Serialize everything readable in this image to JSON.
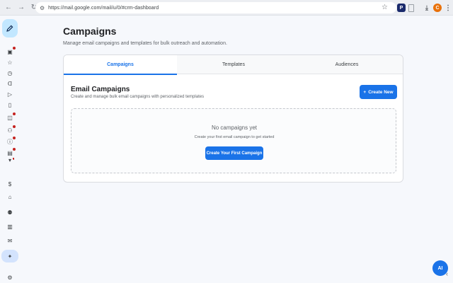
{
  "browser": {
    "url": "https://mail.google.com/mail/u/0/#crm-dashboard",
    "avatar_letter": "C",
    "extension_letter": "P"
  },
  "rail": {
    "icons": [
      {
        "name": "inbox-icon",
        "glyph": "▣",
        "dot": true
      },
      {
        "name": "star-icon",
        "glyph": "☆",
        "dot": false
      },
      {
        "name": "clock-icon",
        "glyph": "◷",
        "dot": false
      },
      {
        "name": "label-icon",
        "glyph": "ᗡ",
        "dot": false
      },
      {
        "name": "send-icon",
        "glyph": "▷",
        "dot": false
      },
      {
        "name": "draft-icon",
        "glyph": "▯",
        "dot": false
      },
      {
        "name": "bag-icon",
        "glyph": "◫",
        "dot": true
      },
      {
        "name": "people-icon",
        "glyph": "⚇",
        "dot": true
      },
      {
        "name": "info-icon",
        "glyph": "ⓘ",
        "dot": true
      },
      {
        "name": "chat-icon",
        "glyph": "▤",
        "dot": true
      },
      {
        "name": "more-icon",
        "glyph": "▾",
        "dot": true
      },
      {
        "name": "dollar-icon",
        "glyph": "$",
        "dot": false
      },
      {
        "name": "home-icon",
        "glyph": "⌂",
        "dot": false
      },
      {
        "name": "contacts-icon",
        "glyph": "⚉",
        "dot": false
      },
      {
        "name": "analytics-icon",
        "glyph": "▥",
        "dot": false
      },
      {
        "name": "campaigns-icon",
        "glyph": "✉",
        "dot": false
      },
      {
        "name": "sparkle-icon",
        "glyph": "✦",
        "dot": false
      },
      {
        "name": "settings-icon",
        "glyph": "⚙",
        "dot": false
      }
    ]
  },
  "page": {
    "title": "Campaigns",
    "subtitle": "Manage email campaigns and templates for bulk outreach and automation."
  },
  "tabs": [
    {
      "label": "Campaigns",
      "active": true
    },
    {
      "label": "Templates",
      "active": false
    },
    {
      "label": "Audiences",
      "active": false
    }
  ],
  "section": {
    "title": "Email Campaigns",
    "description": "Create and manage bulk email campaigns with personalized templates",
    "create_label": "Create New",
    "create_prefix": "+"
  },
  "empty_state": {
    "title": "No campaigns yet",
    "description": "Create your first email campaign to get started",
    "button_label": "Create Your First Campaign"
  },
  "ai_button": {
    "label": "AI"
  },
  "colors": {
    "accent": "#1a73e8",
    "compose_bg": "#c2e7ff",
    "badge": "#c5221f"
  }
}
